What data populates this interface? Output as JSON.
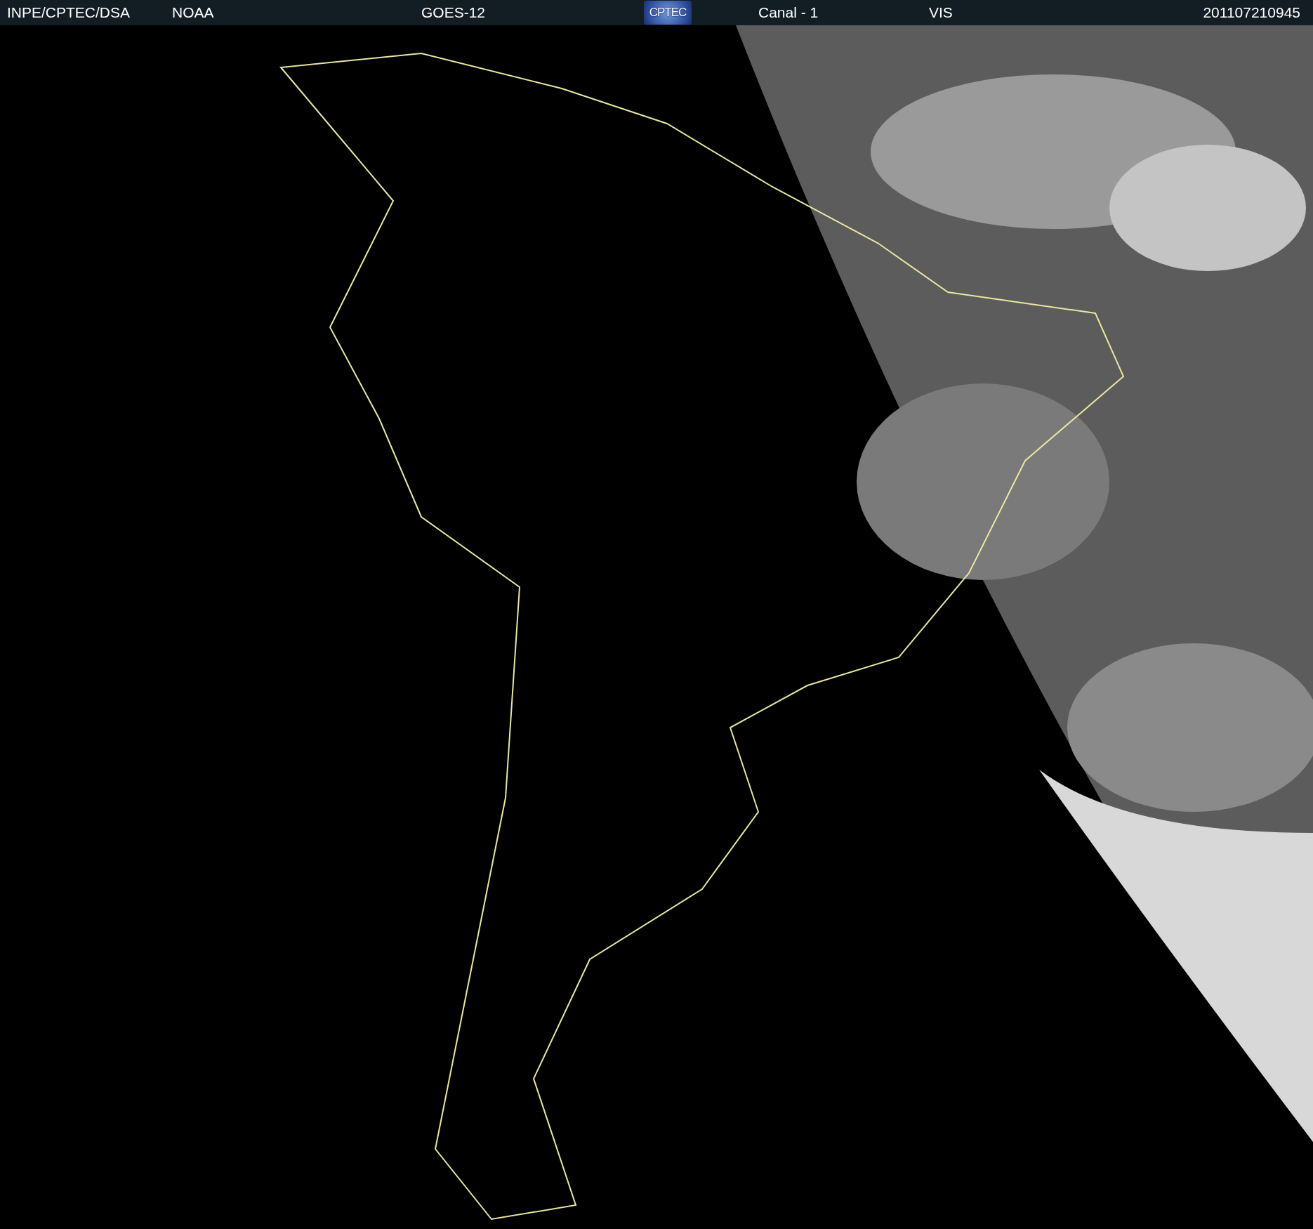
{
  "header": {
    "items": [
      {
        "kind": "text",
        "text": "INPE/CPTEC/DSA"
      },
      {
        "kind": "text",
        "text": "NOAA"
      },
      {
        "kind": "text",
        "text": "GOES-12"
      },
      {
        "kind": "logo",
        "text": "CPTEC"
      },
      {
        "kind": "text",
        "text": "Canal - 1"
      },
      {
        "kind": "text",
        "text": "VIS"
      },
      {
        "kind": "text",
        "text": "201107210945"
      }
    ]
  }
}
